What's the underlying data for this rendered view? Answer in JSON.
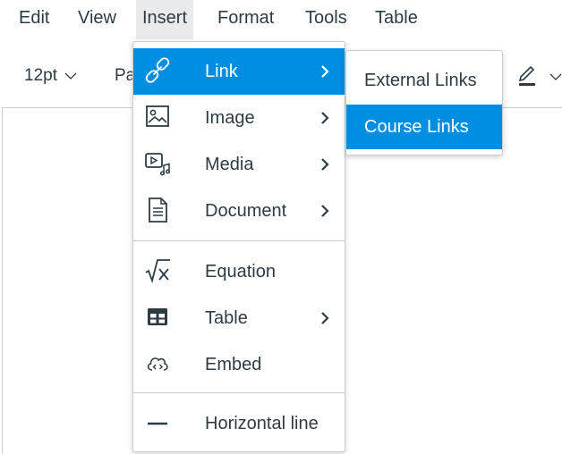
{
  "menubar": {
    "items": [
      {
        "label": "Edit"
      },
      {
        "label": "View"
      },
      {
        "label": "Insert"
      },
      {
        "label": "Format"
      },
      {
        "label": "Tools"
      },
      {
        "label": "Table"
      }
    ]
  },
  "toolbar": {
    "font_size": "12pt",
    "paragraph_partial": "Pa",
    "highlight_icon": "highlighter-icon"
  },
  "insert_menu": {
    "items": [
      {
        "label": "Link",
        "icon": "link-icon",
        "has_submenu": true,
        "selected": true
      },
      {
        "label": "Image",
        "icon": "image-icon",
        "has_submenu": true
      },
      {
        "label": "Media",
        "icon": "media-icon",
        "has_submenu": true
      },
      {
        "label": "Document",
        "icon": "document-icon",
        "has_submenu": true
      },
      {
        "label": "Equation",
        "icon": "equation-icon",
        "has_submenu": false
      },
      {
        "label": "Table",
        "icon": "table-icon",
        "has_submenu": true
      },
      {
        "label": "Embed",
        "icon": "embed-icon",
        "has_submenu": false
      },
      {
        "label": "Horizontal line",
        "icon": "horizontal-line-icon",
        "has_submenu": false
      }
    ]
  },
  "link_submenu": {
    "items": [
      {
        "label": "External Links"
      },
      {
        "label": "Course Links",
        "selected": true
      }
    ]
  },
  "colors": {
    "accent": "#008ee2",
    "text": "#2d3b45",
    "border": "#c7cdd1",
    "menubar_active": "#e9eaeb"
  }
}
